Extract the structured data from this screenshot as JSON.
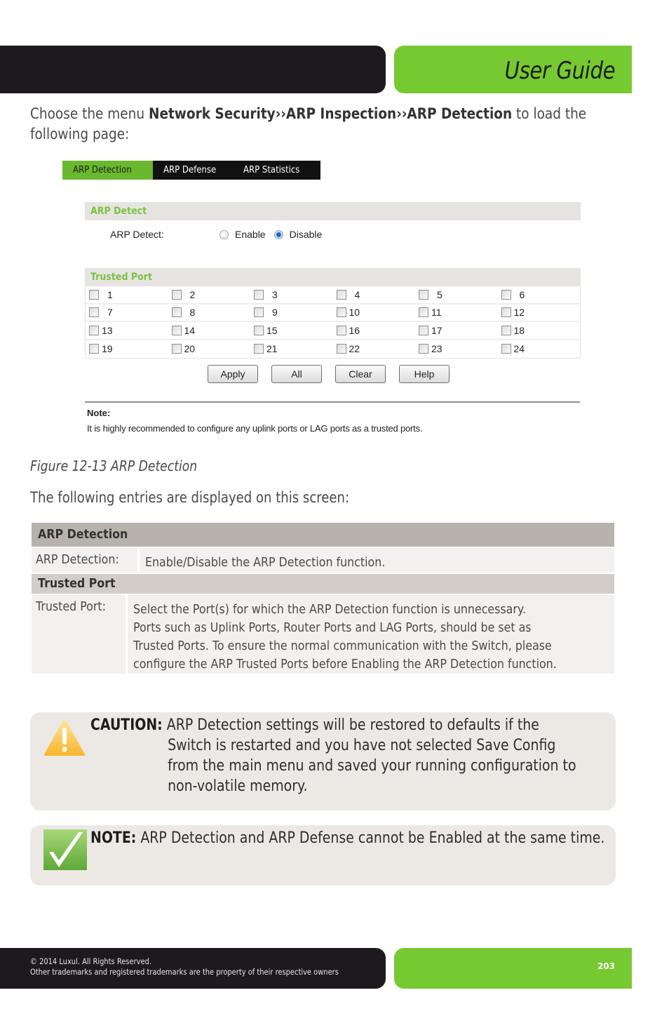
{
  "header": {
    "title": "User Guide",
    "colors": {
      "dark": "#1c1a1d",
      "brand_green": "#76c931"
    }
  },
  "intro": {
    "prefix": "Choose the menu ",
    "menu_path": "Network Security››ARP Inspection››ARP Detection",
    "suffix_line1": " to load the",
    "line2": "following page:"
  },
  "screenshot": {
    "tabs": [
      {
        "label": "ARP Detection",
        "active": true
      },
      {
        "label": "ARP Defense",
        "active": false
      },
      {
        "label": "ARP Statistics",
        "active": false
      }
    ],
    "arp_detect_section": {
      "header": "ARP Detect",
      "field_label": "ARP Detect:",
      "options": [
        {
          "label": "Enable",
          "selected": false
        },
        {
          "label": "Disable",
          "selected": true
        }
      ]
    },
    "trusted_port_section": {
      "header": "Trusted Port",
      "ports": [
        [
          "1",
          "2",
          "3",
          "4",
          "5",
          "6"
        ],
        [
          "7",
          "8",
          "9",
          "10",
          "11",
          "12"
        ],
        [
          "13",
          "14",
          "15",
          "16",
          "17",
          "18"
        ],
        [
          "19",
          "20",
          "21",
          "22",
          "23",
          "24"
        ]
      ]
    },
    "buttons": {
      "apply": "Apply",
      "all": "All",
      "clear": "Clear",
      "help": "Help"
    },
    "note": {
      "title": "Note:",
      "text": "It is highly recommended to configure any uplink ports or LAG ports as a trusted ports."
    }
  },
  "caption": "Figure 12-13 ARP Detection",
  "entries_intro": "The following entries are displayed on this screen:",
  "description_table": {
    "sections": [
      {
        "header": "ARP Detection",
        "key": "ARP Detection:",
        "value_lines": [
          "Enable/Disable the ARP Detection function."
        ]
      },
      {
        "header": "Trusted Port",
        "key": "Trusted Port:",
        "value_lines": [
          "Select the Port(s) for which the ARP Detection function is unnecessary.",
          "Ports such as Uplink Ports, Router Ports and LAG Ports, should be set as",
          "Trusted Ports. To ensure the normal communication with the Switch, please",
          "configure the ARP Trusted Ports before Enabling the ARP Detection function."
        ]
      }
    ]
  },
  "caution": {
    "label": "CAUTION:",
    "lines": [
      "ARP Detection settings will be restored to defaults if the",
      "Switch is restarted and you have not selected Save Config",
      "from the main menu and saved your running configuration to",
      "non-volatile memory."
    ],
    "icon": "warning-triangle-icon"
  },
  "note_callout": {
    "label": "NOTE:",
    "text": "ARP Detection and ARP Defense cannot be Enabled at the same time.",
    "icon": "checkmark-icon"
  },
  "footer": {
    "copyright": "© 2014  Luxul. All Rights Reserved.",
    "trademarks": "Other trademarks and registered trademarks are the property of their respective owners",
    "page_number": "203"
  }
}
